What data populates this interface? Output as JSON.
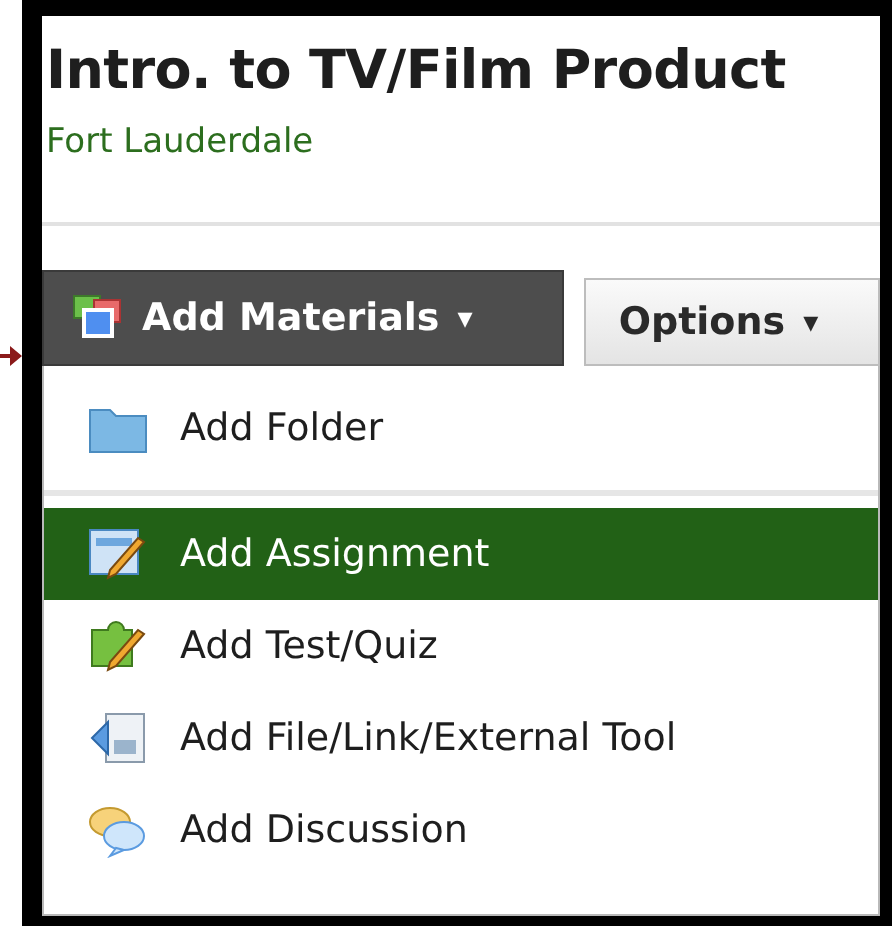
{
  "course": {
    "title": "Intro. to TV/Film Product",
    "campus": "Fort Lauderdale"
  },
  "toolbar": [
    {
      "label": "Add Materials",
      "kind": "primary",
      "caret": "▾"
    },
    {
      "label": "Options",
      "kind": "secondary",
      "caret": "▾"
    }
  ],
  "menu": [
    {
      "label": "Add Folder",
      "kind": "folder",
      "selected": false,
      "separator_after": true
    },
    {
      "label": "Add Assignment",
      "kind": "assignment",
      "selected": true,
      "separator_after": false
    },
    {
      "label": "Add Test/Quiz",
      "kind": "quiz",
      "selected": false,
      "separator_after": false
    },
    {
      "label": "Add File/Link/External Tool",
      "kind": "file",
      "selected": false,
      "separator_after": false
    },
    {
      "label": "Add Discussion",
      "kind": "discussion",
      "selected": false,
      "separator_after": false
    }
  ]
}
